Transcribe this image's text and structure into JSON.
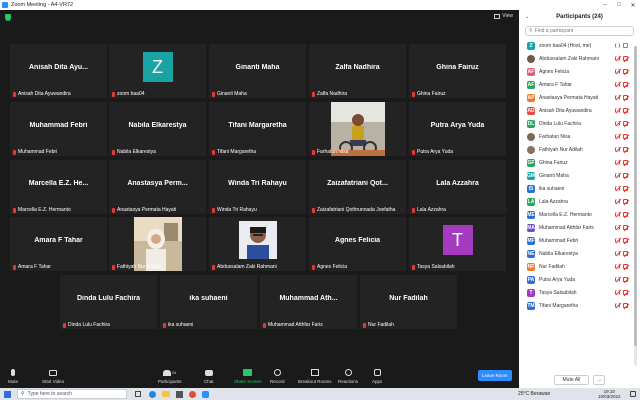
{
  "window": {
    "title": "Zoom Meeting - A4-VR72",
    "view_label": "View"
  },
  "tiles": [
    {
      "name": "Anisah Dita Ayu...",
      "label": "Anisah Dita Ayuwandira"
    },
    {
      "name": "",
      "label": "zoom baa04",
      "avatar": "Z",
      "avatar_color": "#1aa3a3"
    },
    {
      "name": "Ginanti Maha",
      "label": "Ginanti Maha"
    },
    {
      "name": "Zalfa Nadhira",
      "label": "Zalfa Nadhira"
    },
    {
      "name": "Ghina Fairuz",
      "label": "Ghina Fairuz"
    },
    {
      "name": "Muhammad Febri",
      "label": "Muhammad Febri"
    },
    {
      "name": "Nabila Elkarestya",
      "label": "Nabila Elkarestya"
    },
    {
      "name": "Tifani Margaretha",
      "label": "Tifani Margaretha"
    },
    {
      "name": "",
      "label": "Farhatun Nisa",
      "photo": "girl-bike"
    },
    {
      "name": "Putra Arya Yuda",
      "label": "Putra Arya Yuda"
    },
    {
      "name": "Marcella E.Z. He...",
      "label": "Marcella E.Z. Hermanto"
    },
    {
      "name": "Anastasya Perm...",
      "label": "Anastasya Permata Hayati"
    },
    {
      "name": "Winda Tri Rahayu",
      "label": "Winda Tri Rahayu"
    },
    {
      "name": "Zaizafatriani Qot...",
      "label": "Zaizafatriani Qothrunnada Joefatha"
    },
    {
      "name": "Lala Azzahra",
      "label": "Lala Azzahra"
    },
    {
      "name": "Amara F Tahar",
      "label": "Amara F Tahar"
    },
    {
      "name": "",
      "label": "Fathiyah Nur Adilah",
      "photo": "hijab-room"
    },
    {
      "name": "",
      "label": "Abdussalam Zaki Rahmani",
      "photo": "boy"
    },
    {
      "name": "Agnes Felicia",
      "label": "Agnes Felicia"
    },
    {
      "name": "",
      "label": "Tasya Salsabilah",
      "avatar": "T",
      "avatar_color": "#a43bbf"
    },
    {
      "name": "Dinda Lulu Fachira",
      "label": "Dinda Lulu Fachira"
    },
    {
      "name": "ika suhaeni",
      "label": "ika suhaeni"
    },
    {
      "name": "Muhammad Ath...",
      "label": "Muhammad Atthfar Faris"
    },
    {
      "name": "Nur Fadilah",
      "label": "Nur Fadilah"
    }
  ],
  "panel": {
    "title": "Participants (24)",
    "search_placeholder": "Find a participant",
    "mute_all": "Mute All",
    "more": "...",
    "participants": [
      {
        "name": "zoom baa04 (Host, me)",
        "initials": "Z",
        "color": "#1aa3a3",
        "host": true
      },
      {
        "name": "Abdussalam Zaki Rahmani",
        "initials": "",
        "color": "#6d5a4a",
        "photo": true
      },
      {
        "name": "Agnes Felicia",
        "initials": "AF",
        "color": "#e05d7b"
      },
      {
        "name": "Amara F Tahar",
        "initials": "AF",
        "color": "#2ca55c"
      },
      {
        "name": "Anastasya Permata Hayati",
        "initials": "AP",
        "color": "#ef7c2d"
      },
      {
        "name": "Anisah Dita Ayuwandira",
        "initials": "AD",
        "color": "#e24a4a"
      },
      {
        "name": "Dinda Lulu Fachira",
        "initials": "DL",
        "color": "#2ca55c"
      },
      {
        "name": "Farhatun Nisa",
        "initials": "",
        "color": "#7a6a5a",
        "photo": true
      },
      {
        "name": "Fathiyah Nur Adilah",
        "initials": "",
        "color": "#8a7060",
        "photo": true
      },
      {
        "name": "Ghina Fairuz",
        "initials": "GF",
        "color": "#2ca55c"
      },
      {
        "name": "Ginanti Maha",
        "initials": "GM",
        "color": "#1aa3a3"
      },
      {
        "name": "ika suhaeni",
        "initials": "IS",
        "color": "#2d6fd6"
      },
      {
        "name": "Lala Azzahra",
        "initials": "LA",
        "color": "#2ca55c"
      },
      {
        "name": "Marcella E.Z. Hermanto",
        "initials": "ME",
        "color": "#2d6fd6"
      },
      {
        "name": "Muhammad Atthfar Faris",
        "initials": "MA",
        "color": "#6a4fd1"
      },
      {
        "name": "Muhammad Febri",
        "initials": "MF",
        "color": "#2d6fd6"
      },
      {
        "name": "Nabila Elkarestya",
        "initials": "NE",
        "color": "#2d6fd6"
      },
      {
        "name": "Nur Fadilah",
        "initials": "NF",
        "color": "#ef7c2d"
      },
      {
        "name": "Putra Arya Yuda",
        "initials": "PA",
        "color": "#2d6fd6"
      },
      {
        "name": "Tasya Salsabilah",
        "initials": "T",
        "color": "#a43bbf"
      },
      {
        "name": "Tifani Margaretha",
        "initials": "TM",
        "color": "#2d6fd6"
      }
    ]
  },
  "toolbar": {
    "mute": "Mute",
    "start_video": "Start Video",
    "participants": "Participants",
    "participants_count": "24",
    "chat": "Chat",
    "share_screen": "Share Screen",
    "record": "Record",
    "breakout": "Breakout Rooms",
    "reactions": "Reactions",
    "apps": "Apps",
    "leave": "Leave Room"
  },
  "taskbar": {
    "search_placeholder": "Type here to search",
    "weather": "25°C  Berawan",
    "time": "19:10",
    "date": "10/03/2022"
  }
}
